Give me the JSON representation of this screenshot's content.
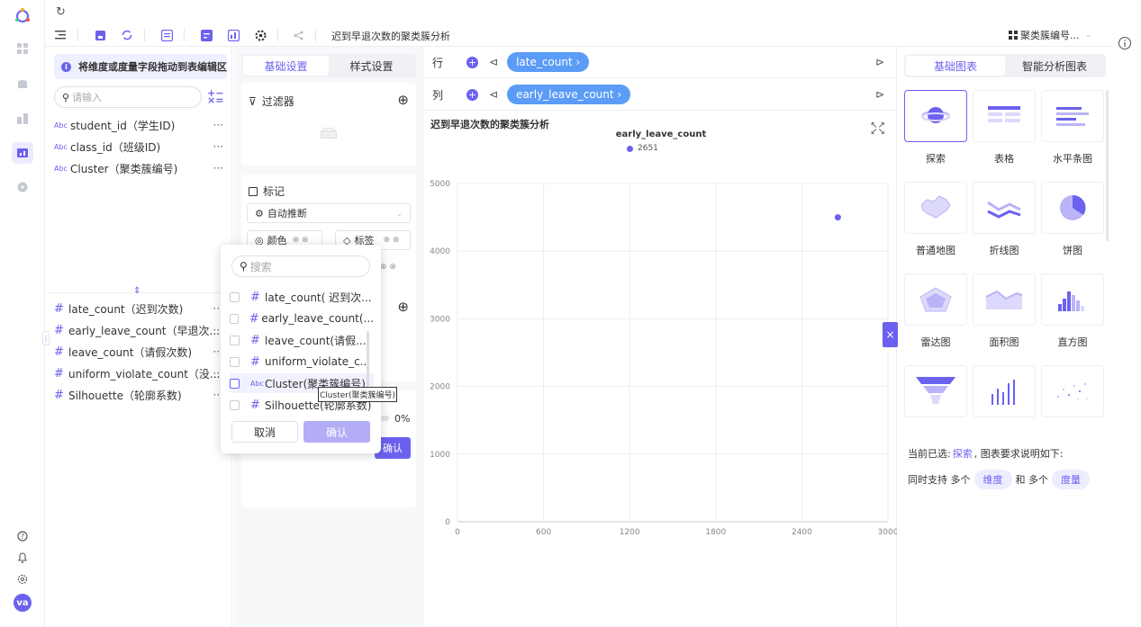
{
  "sidebar": {
    "avatar": "va"
  },
  "toolbar": {
    "title": "迟到早退次数的聚类簇分析",
    "field_select": "聚类簇编号..."
  },
  "left": {
    "hint": "将维度或度量字段拖动到表编辑区",
    "search_placeholder": "请输入",
    "dimensions": [
      {
        "label": "student_id（学生ID)"
      },
      {
        "label": "class_id（班级ID)"
      },
      {
        "label": "Cluster（聚类簇编号)"
      }
    ],
    "measures": [
      {
        "label": "late_count（迟到次数)"
      },
      {
        "label": "early_leave_count（早退次..."
      },
      {
        "label": "leave_count（请假次数)"
      },
      {
        "label": "uniform_violate_count（没..."
      },
      {
        "label": "Silhouette（轮廓系数)"
      }
    ],
    "more": "···"
  },
  "mid": {
    "tabs": [
      "基础设置",
      "样式设置"
    ],
    "filter_label": "过滤器",
    "marks_label": "标记",
    "auto_infer": "自动推断",
    "color_label": "颜色",
    "tag_label": "标签",
    "pct": "0%",
    "confirm": "确认"
  },
  "popup": {
    "search_placeholder": "搜索",
    "items": [
      "late_count( 迟到次...",
      "early_leave_count(...",
      "leave_count(请假...",
      "uniform_violate_c...",
      "Cluster(聚类簇编号)",
      "Silhouette(轮廓系数)"
    ],
    "cancel": "取消",
    "confirm": "确认",
    "tooltip": "Cluster(聚类簇编号)"
  },
  "shelves": {
    "row_label": "行",
    "col_label": "列",
    "row_pill": "late_count ›",
    "col_pill": "early_leave_count ›"
  },
  "chart_data": {
    "type": "scatter",
    "title": "迟到早退次数的聚类簇分析",
    "legend_title": "early_leave_count",
    "series": [
      {
        "name": "2651",
        "color": "#6b61ef",
        "points": [
          {
            "x": 2651,
            "y": 4500
          }
        ]
      }
    ],
    "xlim": [
      0,
      3000
    ],
    "ylim": [
      0,
      5000
    ],
    "xticks": [
      0,
      600,
      1200,
      1800,
      2400,
      3000
    ],
    "yticks": [
      0,
      1000,
      2000,
      3000,
      4000,
      5000
    ],
    "grid": true
  },
  "right": {
    "tabs": [
      "基础图表",
      "智能分析图表"
    ],
    "tiles": [
      {
        "label": "探索",
        "icon": "planet-icon"
      },
      {
        "label": "表格",
        "icon": "table-icon"
      },
      {
        "label": "水平条图",
        "icon": "hbar-icon"
      },
      {
        "label": "普通地图",
        "icon": "map-icon"
      },
      {
        "label": "折线图",
        "icon": "line-icon"
      },
      {
        "label": "饼图",
        "icon": "pie-icon"
      },
      {
        "label": "雷达图",
        "icon": "radar-icon"
      },
      {
        "label": "面积图",
        "icon": "area-icon"
      },
      {
        "label": "直方图",
        "icon": "histogram-icon"
      },
      {
        "label": "",
        "icon": "funnel-icon"
      },
      {
        "label": "",
        "icon": "bar-icon"
      },
      {
        "label": "",
        "icon": "scatter-icon"
      }
    ],
    "selected_prefix": "当前已选:",
    "selected_name": "探索",
    "selected_suffix": ", 图表要求说明如下:",
    "req_prefix": "同时支持 多个",
    "req_dim": "维度",
    "req_and": "和 多个",
    "req_measure": "度量"
  },
  "colors": {
    "accent": "#6b61ef",
    "pill": "#5b9cf6"
  }
}
